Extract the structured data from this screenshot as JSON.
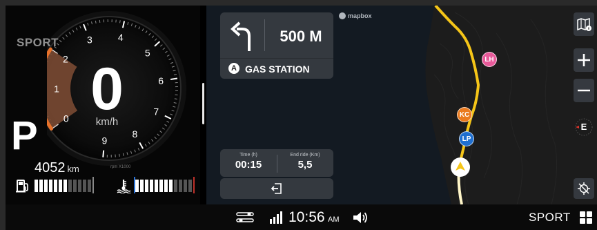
{
  "cluster": {
    "mode": "SPORT",
    "gear": "P",
    "speed": "0",
    "speed_unit": "km/h",
    "odometer": "4052",
    "odometer_unit": "km",
    "rpm_label": "rpm X1000",
    "rpm_ticks": [
      "0",
      "1",
      "2",
      "3",
      "4",
      "5",
      "6",
      "7",
      "8",
      "9"
    ],
    "fuel_level_fraction": 0.6,
    "temp_level_fraction": 0.7,
    "accent_color": "#e8722a"
  },
  "map": {
    "brand": "mapbox",
    "nav": {
      "distance": "500 M",
      "destination_letter": "A",
      "destination": "GAS STATION"
    },
    "stats": {
      "time_label": "Time (h)",
      "time_value": "00:15",
      "end_label": "End ride (Km)",
      "end_value": "5,5"
    },
    "pois": [
      {
        "label": "LH",
        "color": "#e85a9a"
      },
      {
        "label": "KC",
        "color": "#ea7a1e"
      },
      {
        "label": "LP",
        "color": "#1f6fd0"
      }
    ],
    "compass_label": "E",
    "route_color": "#f5c518"
  },
  "status": {
    "time": "10:56",
    "ampm": "AM",
    "mode": "SPORT"
  }
}
